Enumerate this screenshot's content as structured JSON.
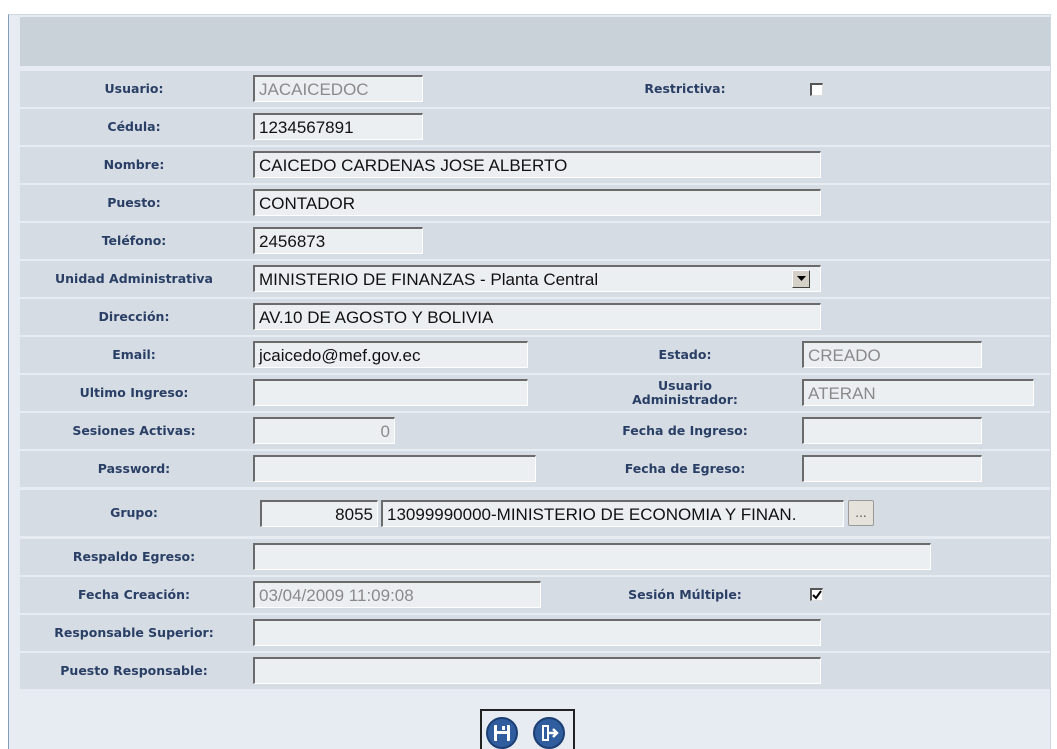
{
  "form": {
    "usuario_label": "Usuario:",
    "usuario_value": "JACAICEDOC",
    "restrictiva_label": "Restrictiva:",
    "restrictiva_checked": false,
    "cedula_label": "Cédula:",
    "cedula_value": "1234567891",
    "nombre_label": "Nombre:",
    "nombre_value": "CAICEDO CARDENAS JOSE ALBERTO",
    "puesto_label": "Puesto:",
    "puesto_value": "CONTADOR",
    "telefono_label": "Teléfono:",
    "telefono_value": "2456873",
    "unidad_label": "Unidad Administrativa",
    "unidad_value": "MINISTERIO DE FINANZAS - Planta Central",
    "direccion_label": "Dirección:",
    "direccion_value": "AV.10 DE AGOSTO Y BOLIVIA",
    "email_label": "Email:",
    "email_value": "jcaicedo@mef.gov.ec",
    "estado_label": "Estado:",
    "estado_value": "CREADO",
    "ultimo_ingreso_label": "Ultimo Ingreso:",
    "ultimo_ingreso_value": "",
    "usuario_admin_label_1": "Usuario",
    "usuario_admin_label_2": "Administrador:",
    "usuario_admin_value": "ATERAN",
    "sesiones_label": "Sesiones Activas:",
    "sesiones_value": "0",
    "fecha_ingreso_label": "Fecha de Ingreso:",
    "fecha_ingreso_value": "",
    "password_label": "Password:",
    "password_value": "",
    "fecha_egreso_label": "Fecha de Egreso:",
    "fecha_egreso_value": "",
    "grupo_label": "Grupo:",
    "grupo_code": "8055",
    "grupo_name": "13099990000-MINISTERIO  DE ECONOMIA Y  FINAN.",
    "grupo_lookup_label": "...",
    "respaldo_label": "Respaldo Egreso:",
    "respaldo_value": "",
    "fecha_creacion_label": "Fecha Creación:",
    "fecha_creacion_value": "03/04/2009 11:09:08",
    "sesion_multiple_label": "Sesión Múltiple:",
    "sesion_multiple_checked": true,
    "responsable_label": "Responsable Superior:",
    "responsable_value": "",
    "puesto_responsable_label": "Puesto Responsable:",
    "puesto_responsable_value": ""
  },
  "actions": {
    "save_icon": "save-icon",
    "exit_icon": "exit-icon"
  },
  "colors": {
    "label_text": "#2a3f66",
    "row_bg": "#d6dce3",
    "button_blue": "#2f5d9e"
  }
}
